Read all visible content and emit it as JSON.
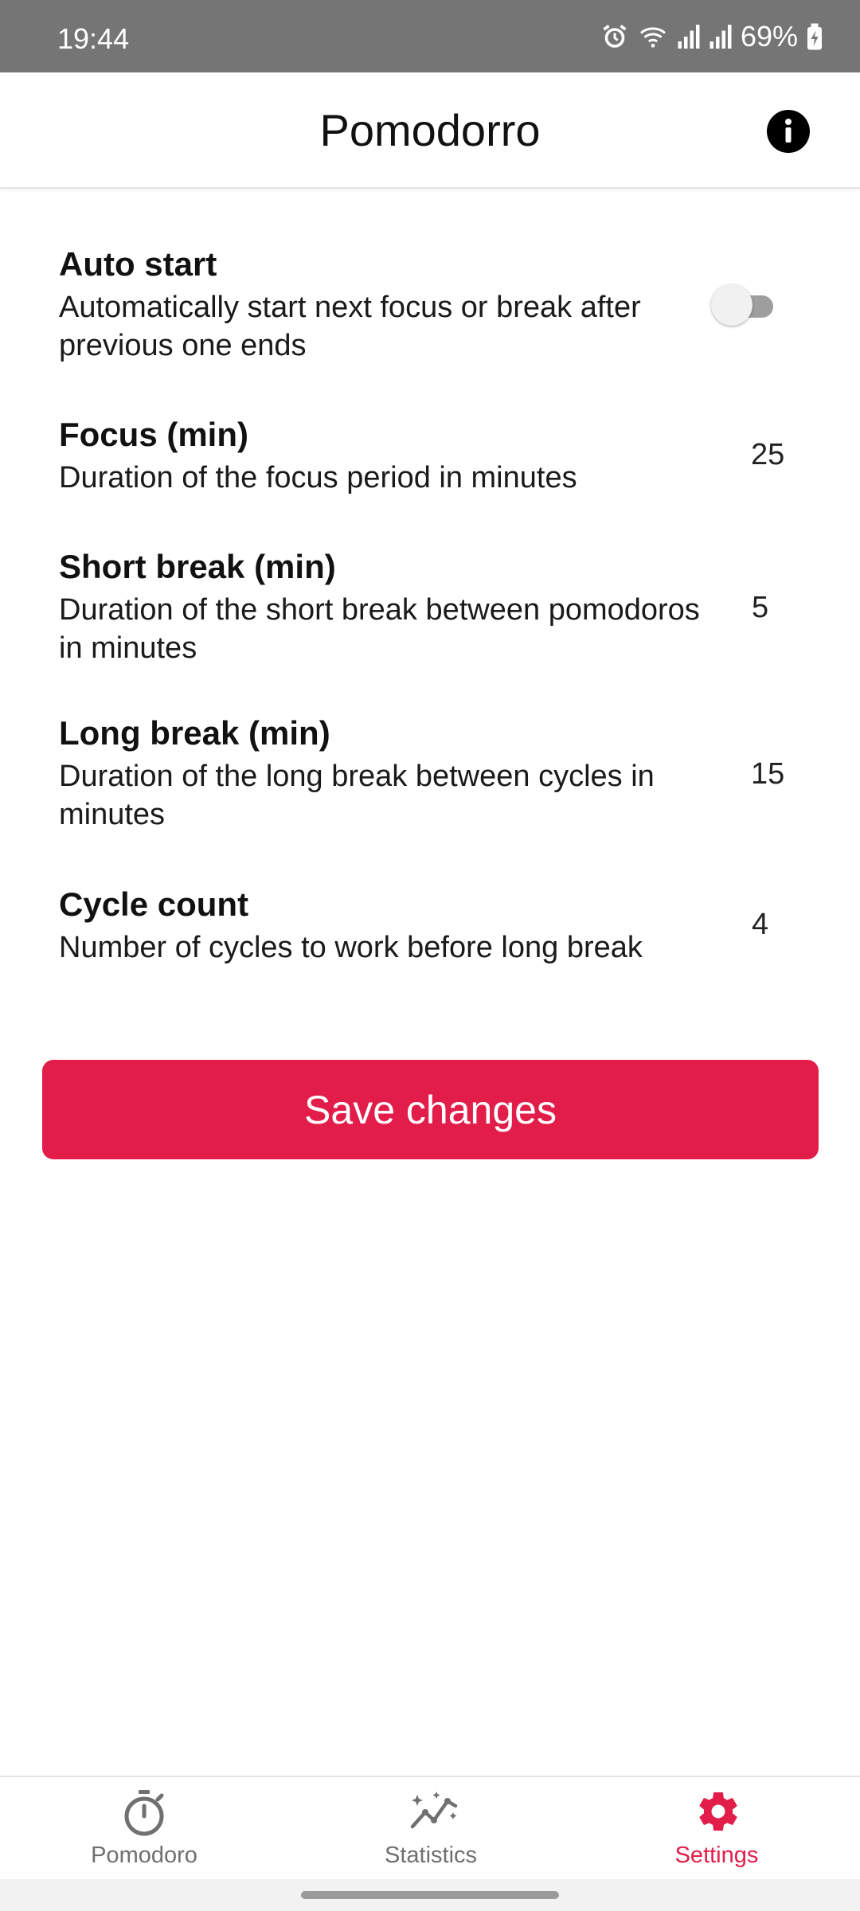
{
  "status_bar": {
    "time": "19:44",
    "battery": "69%",
    "icons": [
      "alarm-icon",
      "wifi-icon",
      "signal-icon",
      "signal-icon",
      "battery-charging-icon"
    ]
  },
  "app_bar": {
    "title": "Pomodorro",
    "info_icon": "info-icon"
  },
  "settings": {
    "auto_start": {
      "title": "Auto start",
      "description": "Automatically start next focus or break after previous one ends",
      "enabled": false
    },
    "focus": {
      "title": "Focus (min)",
      "description": "Duration of the focus period in minutes",
      "value": "25"
    },
    "short_break": {
      "title": "Short break (min)",
      "description": "Duration of the short break between pomodoros in minutes",
      "value": "5"
    },
    "long_break": {
      "title": "Long break (min)",
      "description": "Duration of the long break between cycles in minutes",
      "value": "15"
    },
    "cycle_count": {
      "title": "Cycle count",
      "description": "Number of cycles to work before long break",
      "value": "4"
    }
  },
  "save_button": {
    "label": "Save changes"
  },
  "bottom_nav": {
    "items": [
      {
        "label": "Pomodoro",
        "icon": "timer-icon"
      },
      {
        "label": "Statistics",
        "icon": "statistics-icon"
      },
      {
        "label": "Settings",
        "icon": "gear-icon"
      }
    ],
    "active": "Settings"
  },
  "colors": {
    "accent": "#e21d4a",
    "status_bar": "#757575",
    "inactive_nav": "#6f6f6f"
  }
}
